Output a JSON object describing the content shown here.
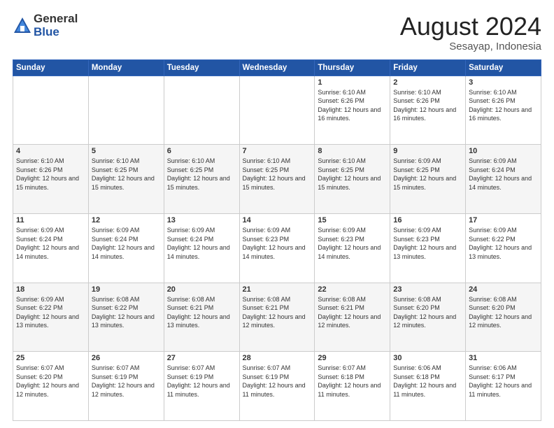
{
  "logo": {
    "general": "General",
    "blue": "Blue"
  },
  "title": "August 2024",
  "location": "Sesayap, Indonesia",
  "weekdays": [
    "Sunday",
    "Monday",
    "Tuesday",
    "Wednesday",
    "Thursday",
    "Friday",
    "Saturday"
  ],
  "weeks": [
    [
      {
        "day": "",
        "info": ""
      },
      {
        "day": "",
        "info": ""
      },
      {
        "day": "",
        "info": ""
      },
      {
        "day": "",
        "info": ""
      },
      {
        "day": "1",
        "info": "Sunrise: 6:10 AM\nSunset: 6:26 PM\nDaylight: 12 hours\nand 16 minutes."
      },
      {
        "day": "2",
        "info": "Sunrise: 6:10 AM\nSunset: 6:26 PM\nDaylight: 12 hours\nand 16 minutes."
      },
      {
        "day": "3",
        "info": "Sunrise: 6:10 AM\nSunset: 6:26 PM\nDaylight: 12 hours\nand 16 minutes."
      }
    ],
    [
      {
        "day": "4",
        "info": "Sunrise: 6:10 AM\nSunset: 6:26 PM\nDaylight: 12 hours\nand 15 minutes."
      },
      {
        "day": "5",
        "info": "Sunrise: 6:10 AM\nSunset: 6:25 PM\nDaylight: 12 hours\nand 15 minutes."
      },
      {
        "day": "6",
        "info": "Sunrise: 6:10 AM\nSunset: 6:25 PM\nDaylight: 12 hours\nand 15 minutes."
      },
      {
        "day": "7",
        "info": "Sunrise: 6:10 AM\nSunset: 6:25 PM\nDaylight: 12 hours\nand 15 minutes."
      },
      {
        "day": "8",
        "info": "Sunrise: 6:10 AM\nSunset: 6:25 PM\nDaylight: 12 hours\nand 15 minutes."
      },
      {
        "day": "9",
        "info": "Sunrise: 6:09 AM\nSunset: 6:25 PM\nDaylight: 12 hours\nand 15 minutes."
      },
      {
        "day": "10",
        "info": "Sunrise: 6:09 AM\nSunset: 6:24 PM\nDaylight: 12 hours\nand 14 minutes."
      }
    ],
    [
      {
        "day": "11",
        "info": "Sunrise: 6:09 AM\nSunset: 6:24 PM\nDaylight: 12 hours\nand 14 minutes."
      },
      {
        "day": "12",
        "info": "Sunrise: 6:09 AM\nSunset: 6:24 PM\nDaylight: 12 hours\nand 14 minutes."
      },
      {
        "day": "13",
        "info": "Sunrise: 6:09 AM\nSunset: 6:24 PM\nDaylight: 12 hours\nand 14 minutes."
      },
      {
        "day": "14",
        "info": "Sunrise: 6:09 AM\nSunset: 6:23 PM\nDaylight: 12 hours\nand 14 minutes."
      },
      {
        "day": "15",
        "info": "Sunrise: 6:09 AM\nSunset: 6:23 PM\nDaylight: 12 hours\nand 14 minutes."
      },
      {
        "day": "16",
        "info": "Sunrise: 6:09 AM\nSunset: 6:23 PM\nDaylight: 12 hours\nand 13 minutes."
      },
      {
        "day": "17",
        "info": "Sunrise: 6:09 AM\nSunset: 6:22 PM\nDaylight: 12 hours\nand 13 minutes."
      }
    ],
    [
      {
        "day": "18",
        "info": "Sunrise: 6:09 AM\nSunset: 6:22 PM\nDaylight: 12 hours\nand 13 minutes."
      },
      {
        "day": "19",
        "info": "Sunrise: 6:08 AM\nSunset: 6:22 PM\nDaylight: 12 hours\nand 13 minutes."
      },
      {
        "day": "20",
        "info": "Sunrise: 6:08 AM\nSunset: 6:21 PM\nDaylight: 12 hours\nand 13 minutes."
      },
      {
        "day": "21",
        "info": "Sunrise: 6:08 AM\nSunset: 6:21 PM\nDaylight: 12 hours\nand 12 minutes."
      },
      {
        "day": "22",
        "info": "Sunrise: 6:08 AM\nSunset: 6:21 PM\nDaylight: 12 hours\nand 12 minutes."
      },
      {
        "day": "23",
        "info": "Sunrise: 6:08 AM\nSunset: 6:20 PM\nDaylight: 12 hours\nand 12 minutes."
      },
      {
        "day": "24",
        "info": "Sunrise: 6:08 AM\nSunset: 6:20 PM\nDaylight: 12 hours\nand 12 minutes."
      }
    ],
    [
      {
        "day": "25",
        "info": "Sunrise: 6:07 AM\nSunset: 6:20 PM\nDaylight: 12 hours\nand 12 minutes."
      },
      {
        "day": "26",
        "info": "Sunrise: 6:07 AM\nSunset: 6:19 PM\nDaylight: 12 hours\nand 12 minutes."
      },
      {
        "day": "27",
        "info": "Sunrise: 6:07 AM\nSunset: 6:19 PM\nDaylight: 12 hours\nand 11 minutes."
      },
      {
        "day": "28",
        "info": "Sunrise: 6:07 AM\nSunset: 6:19 PM\nDaylight: 12 hours\nand 11 minutes."
      },
      {
        "day": "29",
        "info": "Sunrise: 6:07 AM\nSunset: 6:18 PM\nDaylight: 12 hours\nand 11 minutes."
      },
      {
        "day": "30",
        "info": "Sunrise: 6:06 AM\nSunset: 6:18 PM\nDaylight: 12 hours\nand 11 minutes."
      },
      {
        "day": "31",
        "info": "Sunrise: 6:06 AM\nSunset: 6:17 PM\nDaylight: 12 hours\nand 11 minutes."
      }
    ]
  ]
}
